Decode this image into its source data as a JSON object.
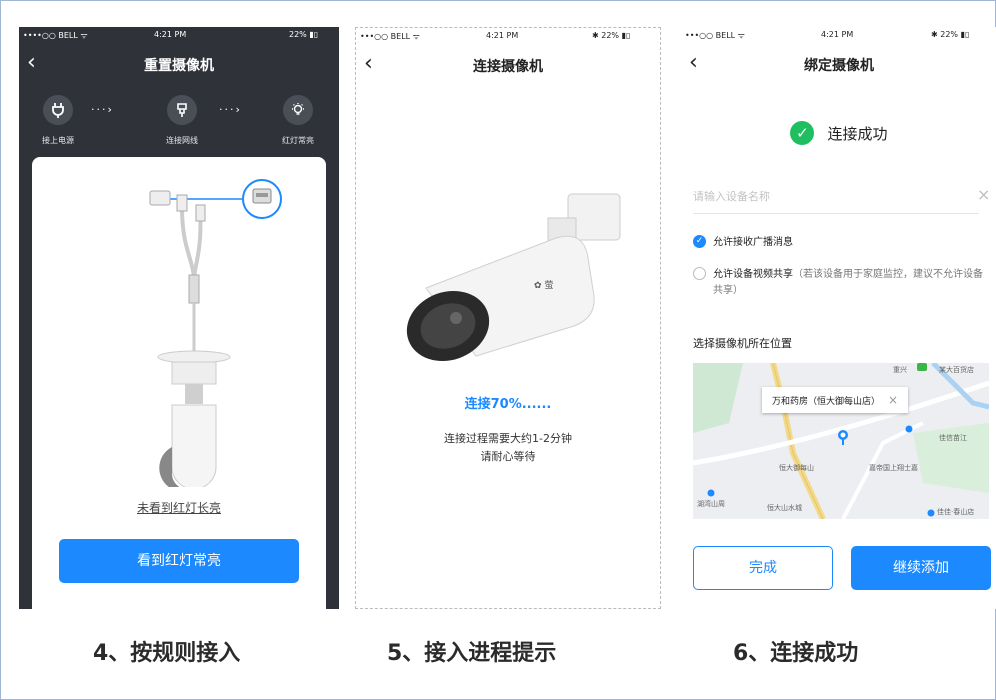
{
  "colors": {
    "accent": "#1c89ff",
    "success": "#1fbf60",
    "dark_bg": "#2f3339"
  },
  "phone1": {
    "status": {
      "carrier": "••••○○ BELL ᯤ",
      "time": "4:21 PM",
      "battery": "22% ▮▯"
    },
    "back_icon": "chevron-left-icon",
    "title": "重置摄像机",
    "steps": [
      {
        "icon": "plug-icon",
        "label": "接上电源"
      },
      {
        "icon": "camera-plug-icon",
        "label": "连接网线"
      },
      {
        "icon": "bulb-icon",
        "label": "红灯常亮"
      }
    ],
    "step_arrow": "···›",
    "link_text": "未看到红灯长亮",
    "button_label": "看到红灯常亮"
  },
  "phone2": {
    "status": {
      "carrier": "•••○○ BELL ᯤ",
      "time": "4:21 PM",
      "battery": "✱ 22% ▮▯"
    },
    "back_icon": "chevron-left-icon",
    "title": "连接摄像机",
    "progress_text": "连接70%......",
    "progress_value": 70,
    "hint_line1": "连接过程需要大约1-2分钟",
    "hint_line2": "请耐心等待"
  },
  "phone3": {
    "status": {
      "carrier": "•••○○ BELL ᯤ",
      "time": "4:21 PM",
      "battery": "✱ 22% ▮▯"
    },
    "back_icon": "chevron-left-icon",
    "title": "绑定摄像机",
    "success_icon": "check-circle-icon",
    "success_text": "连接成功",
    "name_placeholder": "请输入设备名称",
    "clear_icon": "close-icon",
    "clear_glyph": "×",
    "option1": {
      "label": "允许接收广播消息",
      "checked": true,
      "check_glyph": "✓"
    },
    "option2": {
      "label": "允许设备视频共享",
      "note": "（若该设备用于家庭监控，建议不允许设备共享）",
      "checked": false
    },
    "location_title": "选择摄像机所在位置",
    "map": {
      "tooltip": "万和药房（恒大御每山店）",
      "tooltip_close": "×",
      "labels": [
        "重兴",
        "某大百货店",
        "佳信苗江",
        "恒大御每山",
        "嘉帝国上翔士嘉",
        "湖湾山周",
        "恒大山水城",
        "佳佳·春山店"
      ]
    },
    "done_label": "完成",
    "continue_label": "继续添加"
  },
  "captions": [
    "4、按规则接入",
    "5、接入进程提示",
    "6、连接成功"
  ]
}
